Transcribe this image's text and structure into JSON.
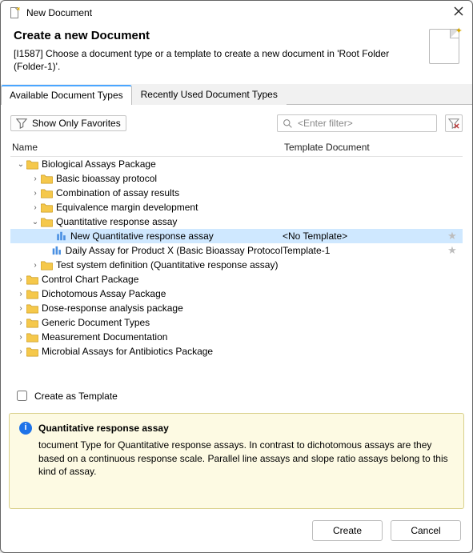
{
  "window": {
    "title": "New Document"
  },
  "header": {
    "heading": "Create a new Document",
    "subtext": "[I1587] Choose a document type or a template to create a new document in 'Root Folder (Folder-1)'."
  },
  "tabs": {
    "available": "Available Document Types",
    "recent": "Recently Used Document Types"
  },
  "toolbar": {
    "favorites_label": "Show Only Favorites",
    "filter_placeholder": "<Enter filter>"
  },
  "columns": {
    "name": "Name",
    "template": "Template Document"
  },
  "tree": [
    {
      "indent": 0,
      "twisty": "down",
      "icon": "folder",
      "label": "Biological Assays Package"
    },
    {
      "indent": 1,
      "twisty": "right",
      "icon": "folder",
      "label": "Basic bioassay protocol"
    },
    {
      "indent": 1,
      "twisty": "right",
      "icon": "folder",
      "label": "Combination of assay results"
    },
    {
      "indent": 1,
      "twisty": "right",
      "icon": "folder",
      "label": "Equivalence margin development"
    },
    {
      "indent": 1,
      "twisty": "down",
      "icon": "folder",
      "label": "Quantitative response assay"
    },
    {
      "indent": 2,
      "twisty": "",
      "icon": "doc",
      "label": "New Quantitative response assay",
      "template": "<No Template>",
      "star": true,
      "selected": true
    },
    {
      "indent": 2,
      "twisty": "",
      "icon": "doc",
      "label": "Daily Assay for Product X (Basic Bioassay Protocol",
      "template": "Template-1",
      "star": true
    },
    {
      "indent": 1,
      "twisty": "right",
      "icon": "folder",
      "label": "Test system definition (Quantitative response assay)"
    },
    {
      "indent": 0,
      "twisty": "right",
      "icon": "folder",
      "label": "Control Chart Package"
    },
    {
      "indent": 0,
      "twisty": "right",
      "icon": "folder",
      "label": "Dichotomous Assay Package"
    },
    {
      "indent": 0,
      "twisty": "right",
      "icon": "folder",
      "label": "Dose-response analysis package"
    },
    {
      "indent": 0,
      "twisty": "right",
      "icon": "folder",
      "label": "Generic Document Types"
    },
    {
      "indent": 0,
      "twisty": "right",
      "icon": "folder",
      "label": "Measurement Documentation"
    },
    {
      "indent": 0,
      "twisty": "right",
      "icon": "folder",
      "label": "Microbial Assays for Antibiotics Package"
    }
  ],
  "checkbox": {
    "label": "Create as Template"
  },
  "description": {
    "title": "Quantitative response assay",
    "body": "tocument Type for Quantitative response assays. In contrast to dichotomous assays are they based on a continuous response scale. Parallel line assays and slope ratio assays belong to this kind of assay."
  },
  "buttons": {
    "create": "Create",
    "cancel": "Cancel"
  }
}
